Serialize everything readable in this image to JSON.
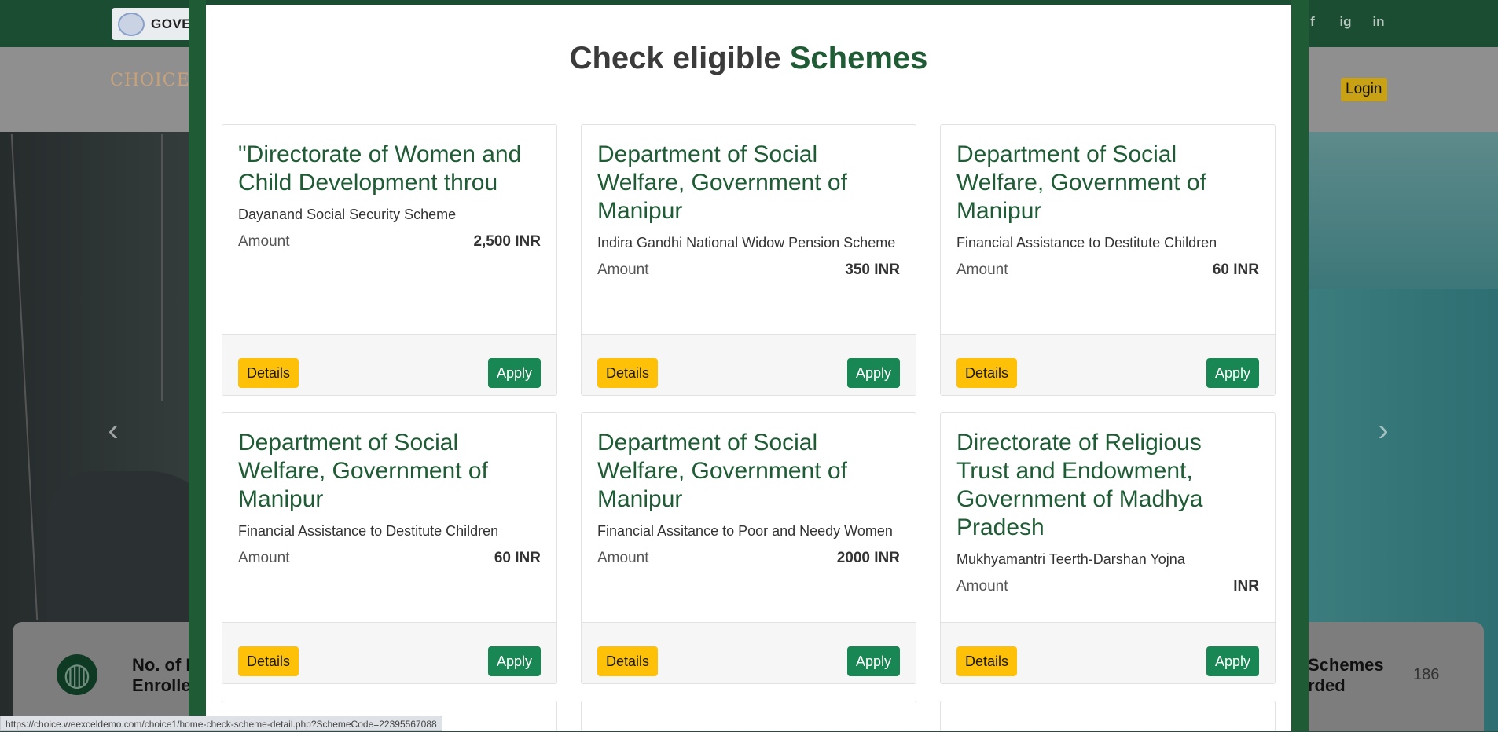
{
  "background": {
    "gov_label": "GOVE",
    "brand": "CHOICE",
    "login_label": "Login",
    "social": [
      "f",
      "ig",
      "in"
    ],
    "stats": {
      "left_label_line1": "No. of F",
      "left_label_line2": "Enrolle",
      "right_label_line1": "Schemes",
      "right_label_line2": "rded",
      "right_value": "186"
    }
  },
  "modal": {
    "title_prefix": "Check eligible",
    "title_accent": "Schemes",
    "cards": [
      {
        "department": "\"Directorate of Women and Child Development throu",
        "scheme": "Dayanand Social Security Scheme",
        "amount_label": "Amount",
        "amount_value": "2,500 INR",
        "details_label": "Details",
        "apply_label": "Apply"
      },
      {
        "department": "Department of Social Welfare, Government of Manipur",
        "scheme": "Indira Gandhi National Widow Pension Scheme",
        "amount_label": "Amount",
        "amount_value": "350 INR",
        "details_label": "Details",
        "apply_label": "Apply"
      },
      {
        "department": "Department of Social Welfare, Government of Manipur",
        "scheme": "Financial Assistance to Destitute Children",
        "amount_label": "Amount",
        "amount_value": "60 INR",
        "details_label": "Details",
        "apply_label": "Apply"
      },
      {
        "department": "Department of Social Welfare, Government of Manipur",
        "scheme": "Financial Assistance to Destitute Children",
        "amount_label": "Amount",
        "amount_value": "60 INR",
        "details_label": "Details",
        "apply_label": "Apply"
      },
      {
        "department": "Department of Social Welfare, Government of Manipur",
        "scheme": "Financial Assitance to Poor and Needy Women",
        "amount_label": "Amount",
        "amount_value": "2000 INR",
        "details_label": "Details",
        "apply_label": "Apply"
      },
      {
        "department": "Directorate of Religious Trust and Endowment, Government of Madhya Pradesh",
        "scheme": "Mukhyamantri Teerth-Darshan Yojna",
        "amount_label": "Amount",
        "amount_value": "INR",
        "details_label": "Details",
        "apply_label": "Apply"
      }
    ]
  },
  "status_bar": {
    "url": "https://choice.weexceldemo.com/choice1/home-check-scheme-detail.php?SchemeCode=22395567088"
  },
  "colors": {
    "brand_green": "#1f5c35",
    "apply_green": "#198754",
    "details_yellow": "#ffc107"
  }
}
